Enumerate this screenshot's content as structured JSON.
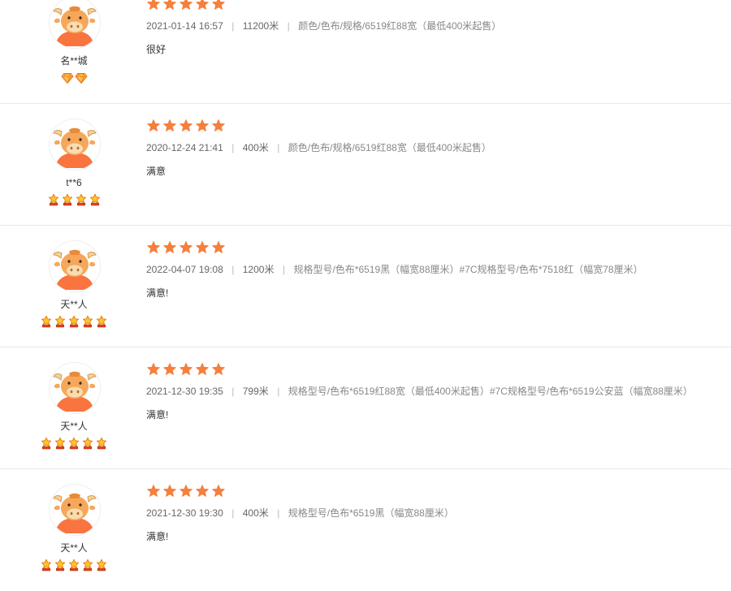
{
  "colors": {
    "star": "#f5803e",
    "divider": "#e8e8e8",
    "avatar_face": "#f6a75a",
    "avatar_shirt": "#f9743f"
  },
  "reviews": [
    {
      "user": "名**城",
      "level_icon": "diamond-icon",
      "level_count": 2,
      "rating": 5,
      "date": "2021-01-14 16:57",
      "quantity": "11200米",
      "spec": "颜色/色布/规格/6519红88宽（最低400米起售）",
      "comment": "很好"
    },
    {
      "user": "t**6",
      "level_icon": "crown-icon",
      "level_count": 4,
      "rating": 5,
      "date": "2020-12-24 21:41",
      "quantity": "400米",
      "spec": "颜色/色布/规格/6519红88宽（最低400米起售）",
      "comment": "满意"
    },
    {
      "user": "天**人",
      "level_icon": "crown-icon",
      "level_count": 5,
      "rating": 5,
      "date": "2022-04-07 19:08",
      "quantity": "1200米",
      "spec": "规格型号/色布*6519黑（幅宽88厘米）#7C规格型号/色布*7518红（幅宽78厘米）",
      "comment": "满意!"
    },
    {
      "user": "天**人",
      "level_icon": "crown-icon",
      "level_count": 5,
      "rating": 5,
      "date": "2021-12-30 19:35",
      "quantity": "799米",
      "spec": "规格型号/色布*6519红88宽（最低400米起售）#7C规格型号/色布*6519公安蓝（幅宽88厘米）",
      "comment": "满意!"
    },
    {
      "user": "天**人",
      "level_icon": "crown-icon",
      "level_count": 5,
      "rating": 5,
      "date": "2021-12-30 19:30",
      "quantity": "400米",
      "spec": "规格型号/色布*6519黑（幅宽88厘米）",
      "comment": "满意!"
    }
  ],
  "separator": "|"
}
